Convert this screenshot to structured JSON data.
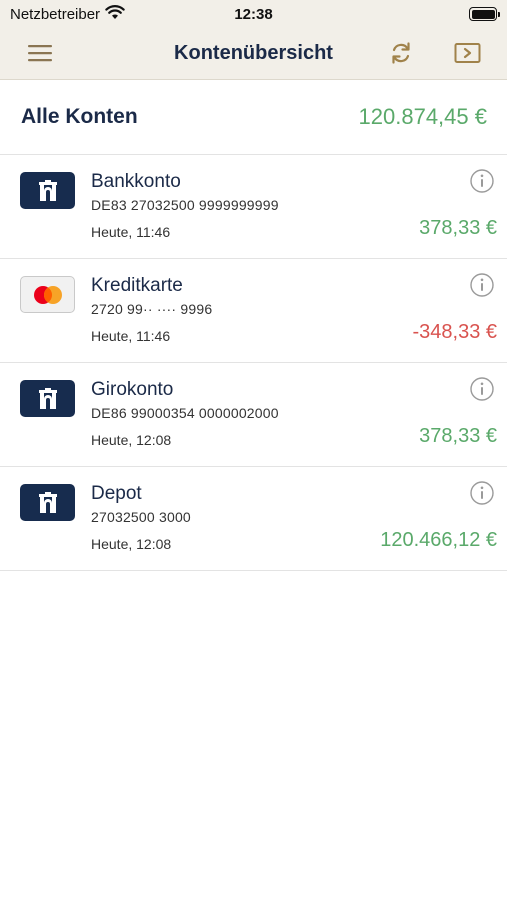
{
  "status_bar": {
    "carrier": "Netzbetreiber",
    "time": "12:38",
    "wifi_icon": "wifi-icon",
    "battery_icon": "battery-icon"
  },
  "nav": {
    "title": "Kontenübersicht",
    "menu_icon": "hamburger-menu-icon",
    "refresh_icon": "refresh-icon",
    "logout_icon": "logout-icon"
  },
  "summary": {
    "label": "Alle Konten",
    "total": "120.874,45 €"
  },
  "accounts": [
    {
      "name": "Bankkonto",
      "number": "DE83 27032500 9999999999",
      "updated": "Heute, 11:46",
      "amount": "378,33 €",
      "type": "bank",
      "sign": "positive"
    },
    {
      "name": "Kreditkarte",
      "number": "2720 99·· ···· 9996",
      "updated": "Heute, 11:46",
      "amount": "-348,33 €",
      "type": "card",
      "sign": "negative"
    },
    {
      "name": "Girokonto",
      "number": "DE86 99000354 0000002000",
      "updated": "Heute, 12:08",
      "amount": "378,33 €",
      "type": "bank",
      "sign": "positive"
    },
    {
      "name": "Depot",
      "number": "27032500 3000",
      "updated": "Heute, 12:08",
      "amount": "120.466,12 €",
      "type": "bank",
      "sign": "positive"
    }
  ],
  "colors": {
    "header_background": "#f2efe8",
    "brand_navy": "#172c4e",
    "accent_gold": "#a0824a",
    "positive": "#5aa96a",
    "negative": "#d9534f",
    "mastercard_red": "#eb001b",
    "mastercard_orange": "#f79e1b"
  }
}
